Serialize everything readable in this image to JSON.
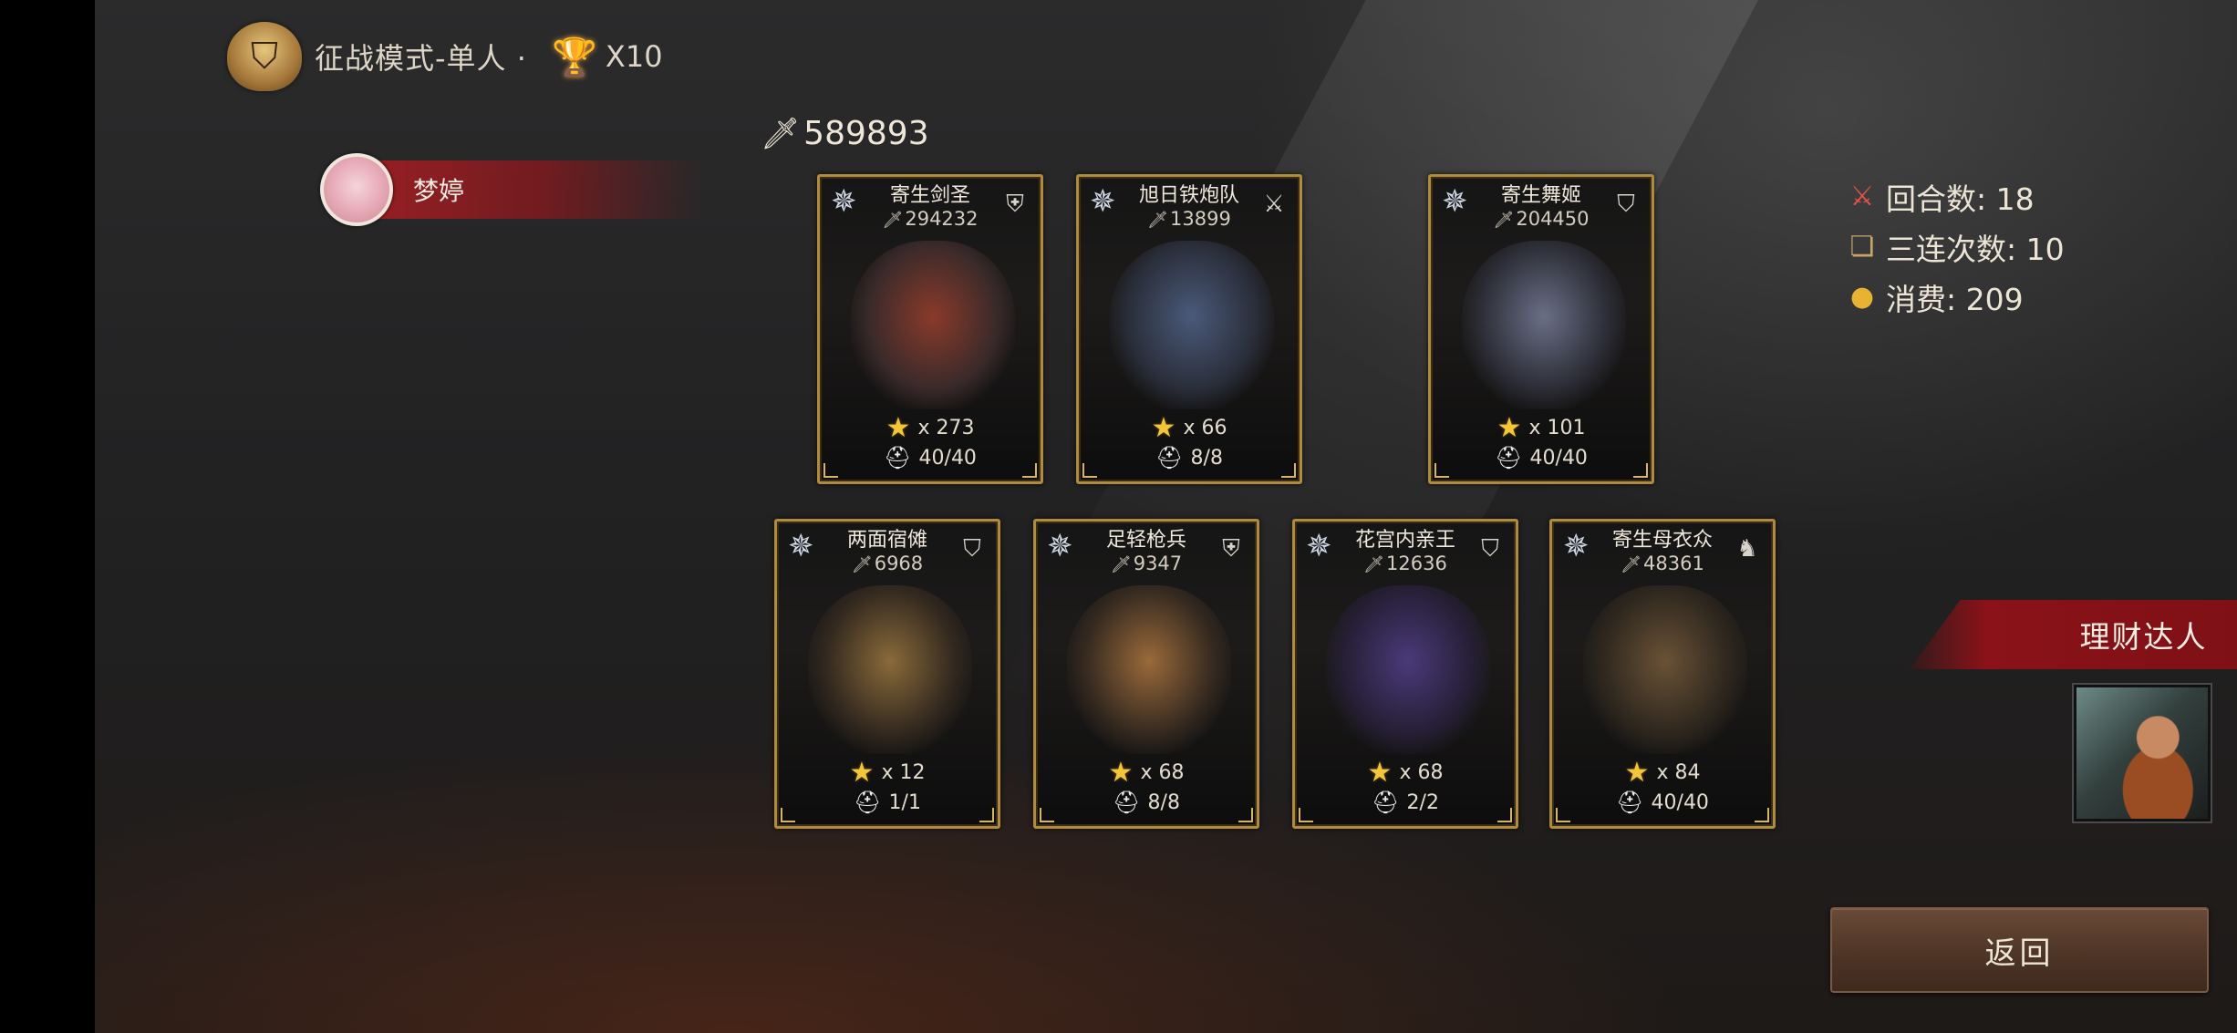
{
  "header": {
    "mode_title": "征战模式-单人 ·",
    "multiplier": "X10",
    "mode_icon": "spartan-helmet-icon",
    "reward_icon": "flaming-chalice-icon"
  },
  "player": {
    "name": "梦婷",
    "total_power": "589893"
  },
  "cards": [
    {
      "name": "寄生剑圣",
      "power": "294232",
      "stars": "x 273",
      "troops": "40/40",
      "class_icon": "shield-icon",
      "figure_color": "#8a3a2a"
    },
    {
      "name": "旭日铁炮队",
      "power": "13899",
      "stars": "x 66",
      "troops": "8/8",
      "class_icon": "crossed-guns-icon",
      "figure_color": "#4a5a7a"
    },
    {
      "name": "寄生舞姬",
      "power": "204450",
      "stars": "x 101",
      "troops": "40/40",
      "class_icon": "helmet-emblem-icon",
      "figure_color": "#6a6f86"
    },
    {
      "name": "两面宿傩",
      "power": "6968",
      "stars": "x 12",
      "troops": "1/1",
      "class_icon": "helmet-emblem-icon",
      "figure_color": "#8a6a3a"
    },
    {
      "name": "足轻枪兵",
      "power": "9347",
      "stars": "x 68",
      "troops": "8/8",
      "class_icon": "shield-icon",
      "figure_color": "#9a6a3a"
    },
    {
      "name": "花宫内亲王",
      "power": "12636",
      "stars": "x 68",
      "troops": "2/2",
      "class_icon": "helmet-emblem-icon",
      "figure_color": "#4a3a7a"
    },
    {
      "name": "寄生母衣众",
      "power": "48361",
      "stars": "x 84",
      "troops": "40/40",
      "class_icon": "horse-head-icon",
      "figure_color": "#6a5236"
    }
  ],
  "stats": {
    "rounds": "回合数: 18",
    "triple_count": "三连次数: 10",
    "cost": "消费: 209"
  },
  "achievement": {
    "title": "理财达人"
  },
  "buttons": {
    "back": "返回"
  },
  "colors": {
    "gold_border": "#b08a3e",
    "banner_red": "#8a1218",
    "button_brown": "#4e3526"
  }
}
